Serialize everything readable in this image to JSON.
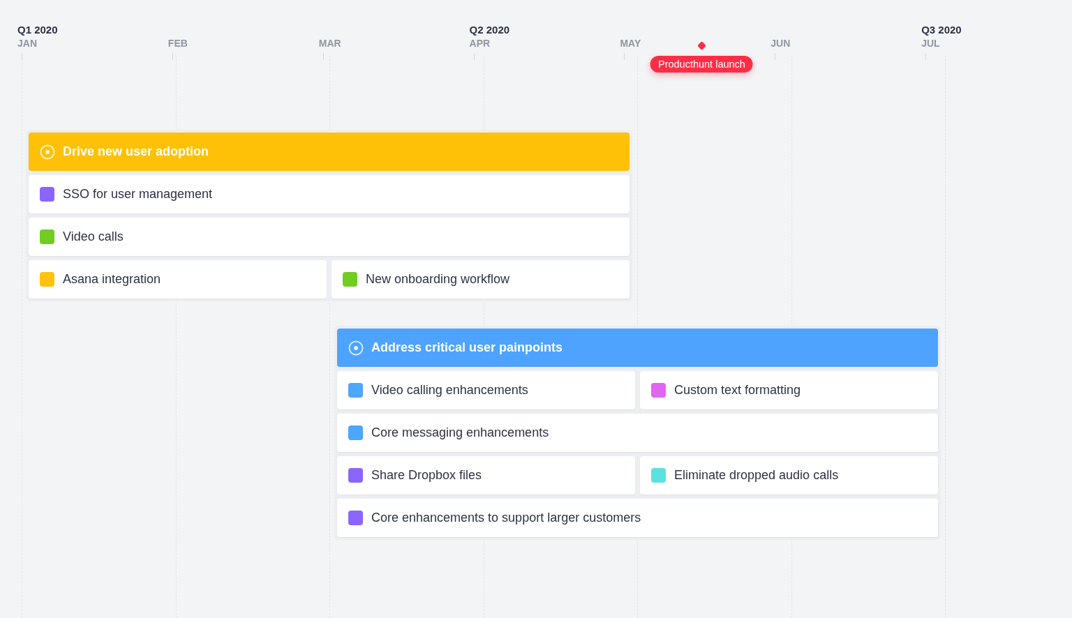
{
  "months": [
    {
      "label": "JAN",
      "quarter": "Q1 2020"
    },
    {
      "label": "FEB"
    },
    {
      "label": "MAR"
    },
    {
      "label": "APR",
      "quarter": "Q2 2020"
    },
    {
      "label": "MAY",
      "milestone": "Producthunt launch"
    },
    {
      "label": "JUN"
    },
    {
      "label": "JUL",
      "quarter": "Q3 2020"
    }
  ],
  "groups": [
    {
      "title": "Drive new user adoption",
      "color": "#ffc107",
      "rows": [
        {
          "items": [
            {
              "label": "SSO for user management",
              "color": "#8a66ff"
            }
          ]
        },
        {
          "items": [
            {
              "label": "Video calls",
              "color": "#72cc22"
            }
          ]
        },
        {
          "items": [
            {
              "label": "Asana integration",
              "color": "#ffc20e"
            },
            {
              "label": "New onboarding workflow",
              "color": "#72cc22"
            }
          ]
        }
      ]
    },
    {
      "title": "Address critical user painpoints",
      "color": "#4da3ff",
      "rows": [
        {
          "items": [
            {
              "label": "Video calling enhancements",
              "color": "#4da6ff"
            },
            {
              "label": "Custom text formatting",
              "color": "#e066f2"
            }
          ]
        },
        {
          "items": [
            {
              "label": "Core messaging enhancements",
              "color": "#4da6ff"
            }
          ]
        },
        {
          "items": [
            {
              "label": "Share Dropbox files",
              "color": "#8a66ff"
            },
            {
              "label": "Eliminate dropped audio calls",
              "color": "#5de0e0"
            }
          ]
        },
        {
          "items": [
            {
              "label": "Core enhancements to support larger customers",
              "color": "#8a66ff"
            }
          ]
        }
      ]
    }
  ]
}
